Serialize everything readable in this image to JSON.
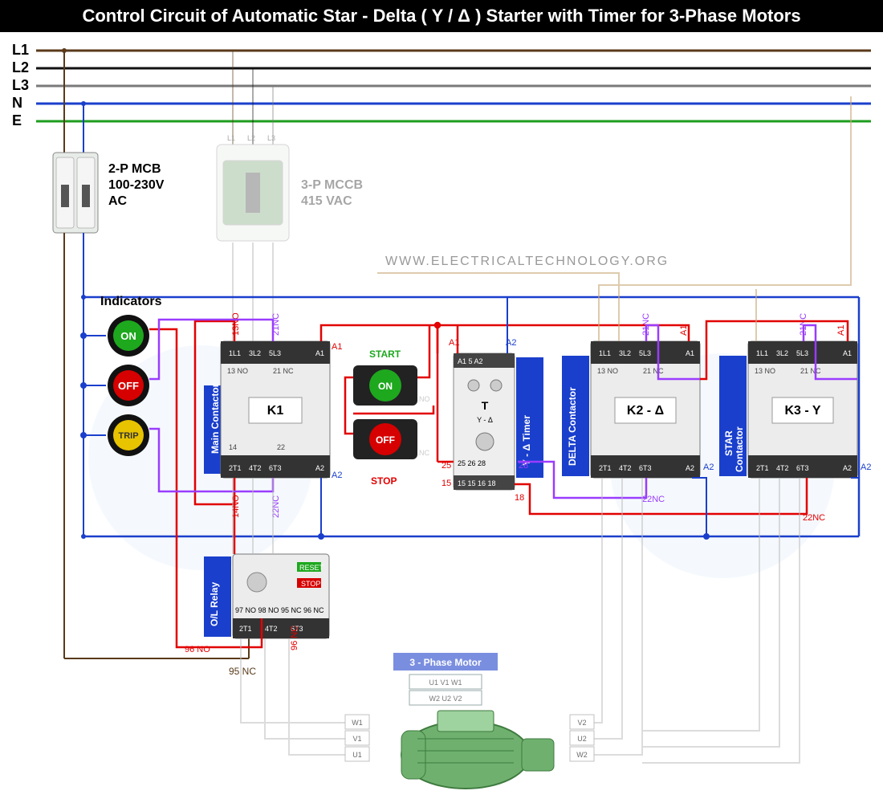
{
  "title": "Control Circuit of Automatic Star - Delta ( Y / Δ ) Starter with Timer for 3-Phase Motors",
  "watermark": "WWW.ELECTRICALTECHNOLOGY.ORG",
  "lines": {
    "L1": "L1",
    "L2": "L2",
    "L3": "L3",
    "N": "N",
    "E": "E"
  },
  "mcb": {
    "label1": "2-P MCB",
    "label2": "100-230V",
    "label3": "AC"
  },
  "mccb": {
    "label1": "3-P MCCB",
    "label2": "415 VAC",
    "t1": "L1",
    "t2": "L2",
    "t3": "L3"
  },
  "indicators": {
    "title": "Indicators",
    "on": "ON",
    "off": "OFF",
    "trip": "TRIP"
  },
  "buttons": {
    "start": "START",
    "on": "ON",
    "stop": "STOP",
    "off": "OFF"
  },
  "contactors": {
    "main": {
      "label": "Main Contactor",
      "code": "K1"
    },
    "delta": {
      "label": "DELTA Contactor",
      "code": "K2 - Δ"
    },
    "star": {
      "label": "STAR Contactor",
      "sub": "Contactor",
      "code": "K3 - Y"
    },
    "top": {
      "l1": "1L1",
      "l2": "3L2",
      "l3": "5L3",
      "a1": "A1",
      "no13": "13 NO",
      "nc21": "21 NC"
    },
    "bot": {
      "t1": "2T1",
      "t2": "4T2",
      "t3": "6T3",
      "a2": "A2",
      "no14": "14",
      "nc22": "22"
    }
  },
  "overload": {
    "label": "O/L Relay"
  },
  "timer": {
    "label": "Y - Δ Timer",
    "t": "T",
    "sub": "Y - Δ"
  },
  "motor": {
    "label": "3 - Phase Motor",
    "u1": "U1",
    "v1": "V1",
    "w1": "W1",
    "u2": "U2",
    "v2": "V2",
    "w2": "W2"
  },
  "annotations": {
    "main_13no": "13NO",
    "main_21nc": "21NC",
    "main_14no": "14NO",
    "main_22nc": "22NC",
    "main_a1": "A1",
    "main_a2": "A2",
    "timer_a1": "A1",
    "timer_a2": "A2",
    "delta_21nc": "21NC",
    "delta_a1": "A1",
    "delta_a2": "A2",
    "delta_22nc": "22NC",
    "star_21nc": "21NC",
    "star_a1": "A1",
    "star_a2": "A2",
    "star_22nc": "22NC",
    "t25": "25",
    "t15": "15",
    "t18": "18",
    "t28": "28",
    "ol_96no": "96 NO",
    "ol_96nc": "96 NC",
    "ol_95nc": "95 NC"
  },
  "colors": {
    "L1": "#5a3a1a",
    "L2": "#111",
    "L3": "#7a7a7a",
    "N": "#1a3fcc",
    "E": "#1e9c1e",
    "red": "#e20000",
    "purple": "#9a3cff",
    "green_btn": "#1ea81e",
    "red_btn": "#d60000",
    "yellow": "#e8c300",
    "tan": "#c9a97a",
    "gray": "#9a9a9a",
    "blue": "#1a3fcc",
    "lightgray": "#c5c5c5"
  }
}
